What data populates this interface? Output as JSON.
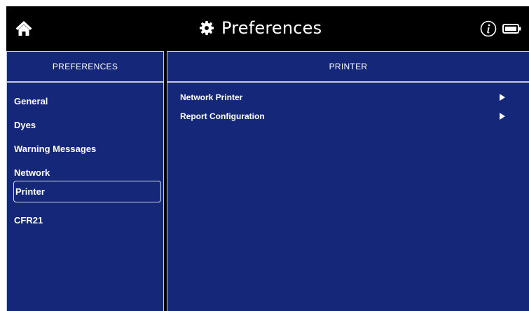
{
  "header": {
    "title": "Preferences",
    "home_icon": "home-icon",
    "settings_icon": "gear-icon",
    "info_icon": "info-icon",
    "battery_icon": "battery-icon"
  },
  "sidebar": {
    "title": "PREFERENCES",
    "selected": "Printer",
    "items": [
      {
        "label": "General"
      },
      {
        "label": "Dyes"
      },
      {
        "label": "Warning Messages"
      },
      {
        "label": "Network"
      },
      {
        "label": "Printer"
      },
      {
        "label": "CFR21"
      }
    ]
  },
  "main": {
    "title": "PRINTER",
    "items": [
      {
        "label": "Network Printer",
        "icon": "chevron-right-icon"
      },
      {
        "label": "Report Configuration",
        "icon": "chevron-right-icon"
      }
    ]
  },
  "colors": {
    "panel_background": "#142779",
    "header_background": "#000000",
    "text": "#ffffff"
  }
}
